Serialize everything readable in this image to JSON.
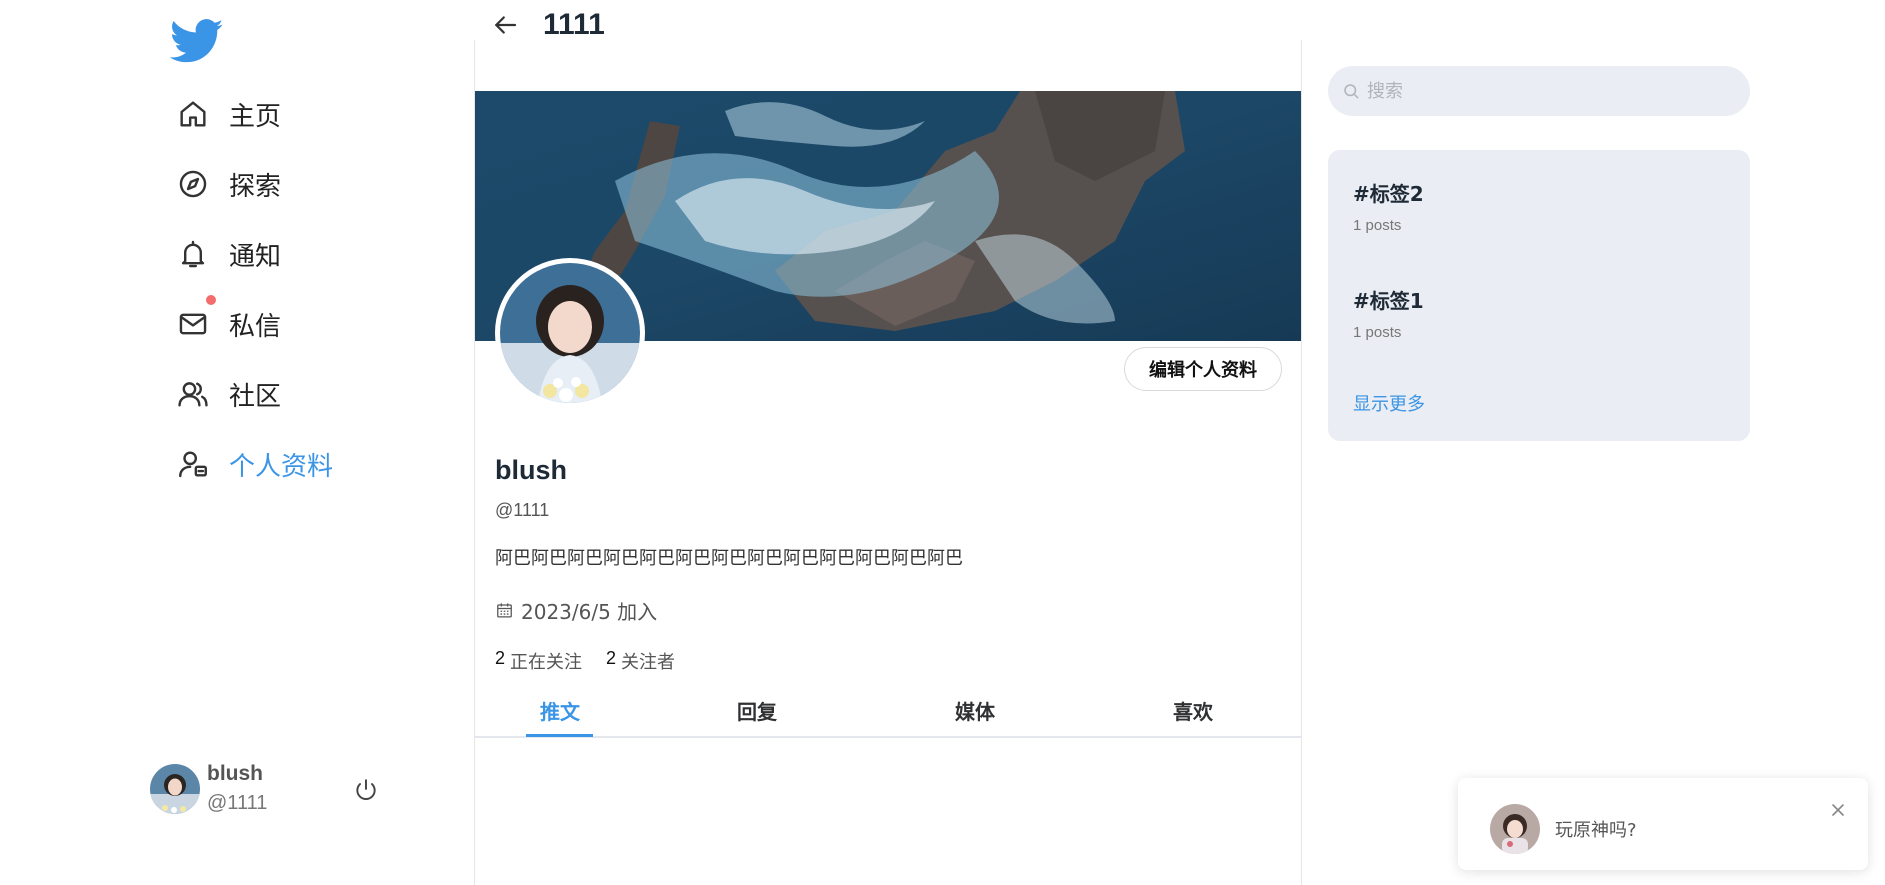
{
  "sidebar": {
    "items": [
      {
        "label": "主页",
        "icon": "home-icon"
      },
      {
        "label": "探索",
        "icon": "compass-icon"
      },
      {
        "label": "通知",
        "icon": "bell-icon"
      },
      {
        "label": "私信",
        "icon": "mail-icon"
      },
      {
        "label": "社区",
        "icon": "users-icon"
      },
      {
        "label": "个人资料",
        "icon": "profile-card-icon"
      }
    ],
    "active_index": 5,
    "user": {
      "name": "blush",
      "handle": "@1111"
    }
  },
  "header": {
    "title": "1111"
  },
  "profile": {
    "edit_label": "编辑个人资料",
    "name": "blush",
    "handle": "@1111",
    "bio": "阿巴阿巴阿巴阿巴阿巴阿巴阿巴阿巴阿巴阿巴阿巴阿巴阿巴",
    "joined": "2023/6/5 加入",
    "following_count": "2",
    "following_label": "正在关注",
    "followers_count": "2",
    "followers_label": "关注者"
  },
  "tabs": [
    {
      "label": "推文"
    },
    {
      "label": "回复"
    },
    {
      "label": "媒体"
    },
    {
      "label": "喜欢"
    }
  ],
  "search": {
    "placeholder": "搜索"
  },
  "trends": {
    "items": [
      {
        "tag": "#标签2",
        "count": "1 posts"
      },
      {
        "tag": "#标签1",
        "count": "1 posts"
      }
    ],
    "more_label": "显示更多"
  },
  "notification": {
    "message": "玩原神吗?"
  },
  "colors": {
    "accent": "#3b95e6",
    "badge": "#f56c6c",
    "panel": "#eaedf3"
  }
}
